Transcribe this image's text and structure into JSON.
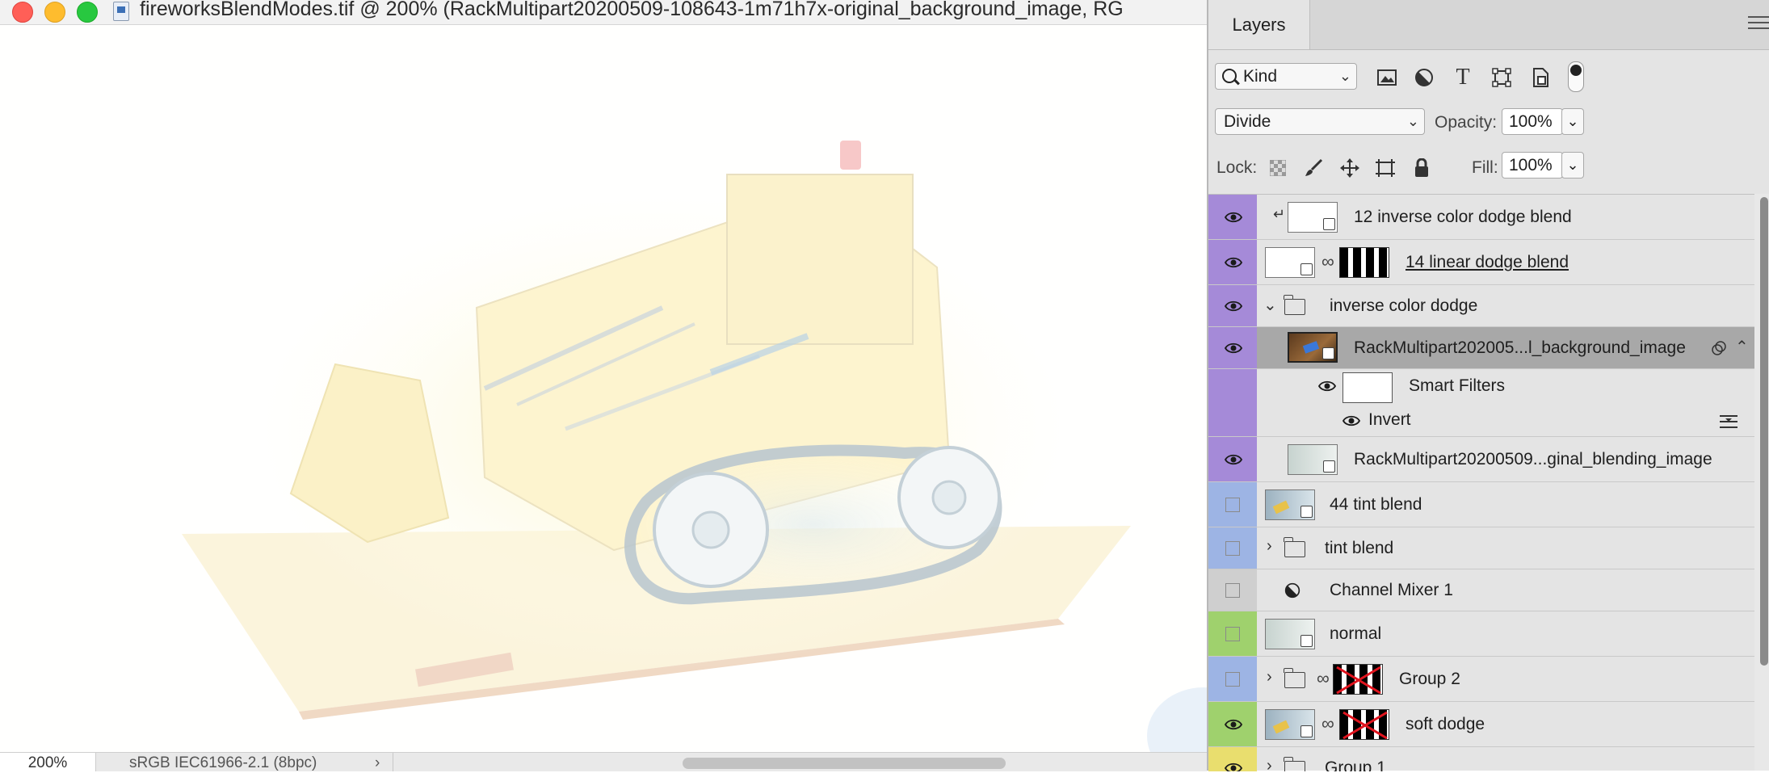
{
  "window": {
    "title": "fireworksBlendModes.tif @ 200% (RackMultipart20200509-108643-1m71h7x-original_background_image, RG"
  },
  "status_bar": {
    "zoom": "200%",
    "color_profile": "sRGB IEC61966-2.1 (8bpc)",
    "arrow": "›"
  },
  "panel": {
    "tab_label": "Layers",
    "filter_kind": "Kind",
    "filter_icons": [
      "image-filter-icon",
      "adjustment-filter-icon",
      "type-filter-icon",
      "shape-filter-icon",
      "smart-object-filter-icon"
    ],
    "blend_mode": "Divide",
    "opacity_label": "Opacity:",
    "opacity_value": "100%",
    "lock_label": "Lock:",
    "fill_label": "Fill:",
    "fill_value": "100%"
  },
  "colors": {
    "purple": "#a58ad8",
    "blue": "#9db4e4",
    "gray": "#cfcfcf",
    "green": "#9fd16d",
    "yellow": "#e9de6e"
  },
  "layers": [
    {
      "name": "12 inverse color dodge blend",
      "color": "purple",
      "visible": true
    },
    {
      "name": "14 linear dodge blend",
      "color": "purple",
      "visible": true
    },
    {
      "name": "inverse color dodge",
      "color": "purple",
      "visible": true
    },
    {
      "name": "RackMultipart202005...l_background_image",
      "color": "purple",
      "visible": true,
      "selected": true
    },
    {
      "name": "Smart Filters",
      "color": "purple",
      "visible": true
    },
    {
      "name": "Invert",
      "color": "purple",
      "visible": true
    },
    {
      "name": "RackMultipart20200509...ginal_blending_image",
      "color": "purple",
      "visible": true
    },
    {
      "name": "44 tint blend",
      "color": "blue",
      "visible": false
    },
    {
      "name": "tint blend",
      "color": "blue",
      "visible": false
    },
    {
      "name": "Channel Mixer 1",
      "color": "gray",
      "visible": false
    },
    {
      "name": "normal",
      "color": "green",
      "visible": false
    },
    {
      "name": "Group 2",
      "color": "blue",
      "visible": false
    },
    {
      "name": "soft dodge",
      "color": "green",
      "visible": true
    },
    {
      "name": "Group 1",
      "color": "yellow",
      "visible": true
    }
  ]
}
